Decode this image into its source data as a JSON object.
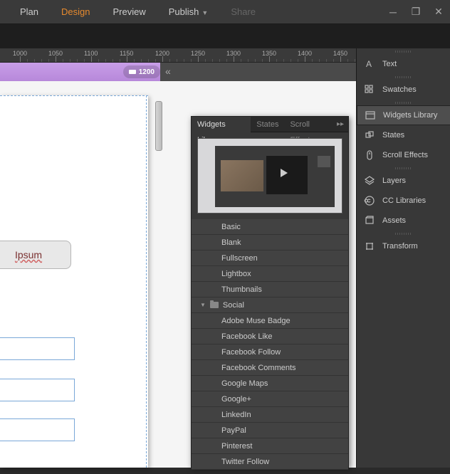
{
  "menu": {
    "items": [
      {
        "label": "Plan",
        "state": "normal"
      },
      {
        "label": "Design",
        "state": "active"
      },
      {
        "label": "Preview",
        "state": "normal"
      },
      {
        "label": "Publish",
        "state": "normal",
        "dropdown": true
      },
      {
        "label": "Share",
        "state": "disabled"
      }
    ]
  },
  "ruler": {
    "ticks": [
      "1000",
      "1050",
      "1100",
      "1150",
      "1200",
      "1250",
      "1300",
      "1350",
      "1400",
      "1450"
    ]
  },
  "breakpoint": {
    "label": "1200"
  },
  "canvas": {
    "lorem": "Ipsum"
  },
  "widgets_panel": {
    "tabs": [
      "Widgets Library",
      "States",
      "Scroll Effect"
    ],
    "active_tab": 0,
    "list": [
      {
        "label": "Basic",
        "type": "item"
      },
      {
        "label": "Blank",
        "type": "item"
      },
      {
        "label": "Fullscreen",
        "type": "item"
      },
      {
        "label": "Lightbox",
        "type": "item"
      },
      {
        "label": "Thumbnails",
        "type": "item"
      },
      {
        "label": "Social",
        "type": "folder"
      },
      {
        "label": "Adobe Muse Badge",
        "type": "item"
      },
      {
        "label": "Facebook Like",
        "type": "item"
      },
      {
        "label": "Facebook Follow",
        "type": "item"
      },
      {
        "label": "Facebook Comments",
        "type": "item"
      },
      {
        "label": "Google Maps",
        "type": "item"
      },
      {
        "label": "Google+",
        "type": "item"
      },
      {
        "label": "LinkedIn",
        "type": "item"
      },
      {
        "label": "PayPal",
        "type": "item"
      },
      {
        "label": "Pinterest",
        "type": "item"
      },
      {
        "label": "Twitter Follow",
        "type": "item"
      }
    ]
  },
  "dock": {
    "groups": [
      [
        {
          "label": "Text",
          "icon": "text"
        }
      ],
      [
        {
          "label": "Swatches",
          "icon": "swatches"
        }
      ],
      [
        {
          "label": "Widgets Library",
          "icon": "widgets",
          "active": true
        },
        {
          "label": "States",
          "icon": "states"
        },
        {
          "label": "Scroll Effects",
          "icon": "scroll"
        }
      ],
      [
        {
          "label": "Layers",
          "icon": "layers"
        },
        {
          "label": "CC Libraries",
          "icon": "cc"
        },
        {
          "label": "Assets",
          "icon": "assets"
        }
      ],
      [
        {
          "label": "Transform",
          "icon": "transform"
        }
      ]
    ]
  }
}
